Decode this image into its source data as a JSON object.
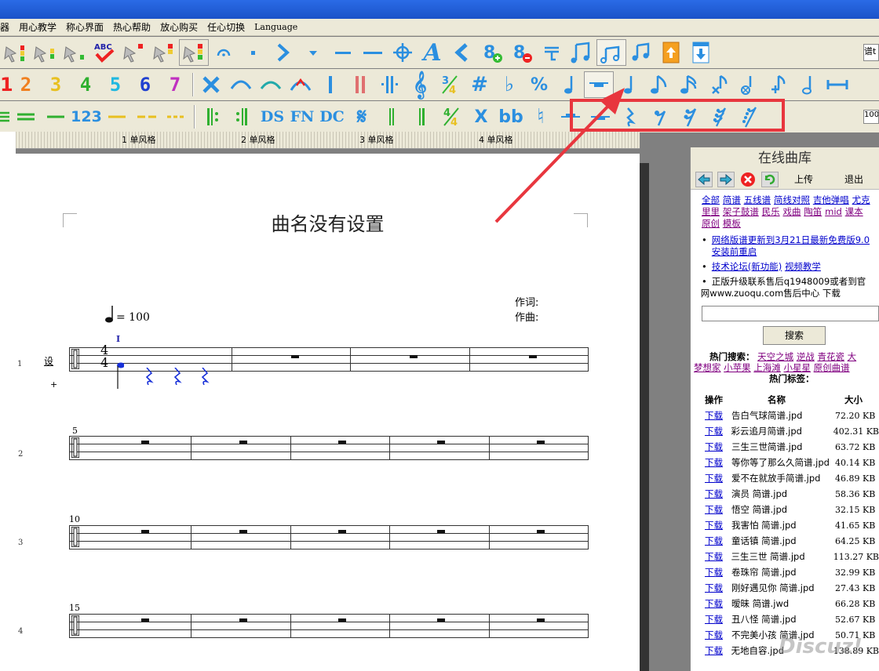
{
  "menu": [
    "器",
    "用心教学",
    "称心界面",
    "热心帮助",
    "放心购买",
    "任心切换",
    "Language"
  ],
  "toolbar2_numbers": [
    "1",
    "2",
    "3",
    "4",
    "5",
    "6",
    "7"
  ],
  "toolbar3_text": [
    "123",
    "DS",
    "FN",
    "DC",
    "X",
    "bb"
  ],
  "right_field_top": "谱t",
  "right_field_mid": "100",
  "ruler": [
    "1 单风格",
    "2 单风格",
    "3 单风格",
    "4 单风格"
  ],
  "score": {
    "title": "曲名没有设置",
    "tempo": "= 100",
    "lyricist": "作词:",
    "composer": "作曲:",
    "marker": "I",
    "setting": "设",
    "plus": "+",
    "time_sig_top": "4",
    "time_sig_bottom": "4",
    "measure_numbers": [
      "5",
      "10",
      "15"
    ],
    "line_numbers": [
      "1",
      "2",
      "3",
      "4"
    ]
  },
  "panel": {
    "title": "在线曲库",
    "upload": "上传",
    "exit": "退出",
    "categories_line1": [
      "全部",
      "简谱",
      "五线谱",
      "简线对照",
      "吉他弹唱",
      "尤克"
    ],
    "categories_line2": [
      "里里",
      "架子鼓谱",
      "民乐",
      "戏曲",
      "陶笛",
      "mid",
      "课本"
    ],
    "categories_line3": [
      "原创",
      "模板"
    ],
    "news1": "网络版谱更新到3月21日最新免费版9.0安装前重启",
    "news2a": "技术论坛(新功能)",
    "news2b": "视频教学",
    "news3": "正版升级联系售后q1948009或者到官网www.zuoqu.com售后中心 下载",
    "search_button": "搜索",
    "hot_search_label": "热门搜索：",
    "hot_search": [
      "天空之城",
      "逆战",
      "青花瓷",
      "大",
      "梦想家",
      "小苹果",
      "上海滩",
      "小星星",
      "原创曲谱"
    ],
    "hot_tags_label": "热门标签：",
    "col_action": "操作",
    "col_name": "名称",
    "col_size": "大小",
    "files": [
      {
        "action": "下载",
        "name": "告白气球简谱.jpd",
        "size": "72.20 KB"
      },
      {
        "action": "下载",
        "name": "彩云追月简谱.jpd",
        "size": "402.31 KB"
      },
      {
        "action": "下载",
        "name": "三生三世简谱.jpd",
        "size": "63.72 KB"
      },
      {
        "action": "下载",
        "name": "等你等了那么久简谱.jpd",
        "size": "40.14 KB"
      },
      {
        "action": "下载",
        "name": "爱不在就放手简谱.jpd",
        "size": "46.89 KB"
      },
      {
        "action": "下载",
        "name": "演员 简谱.jpd",
        "size": "58.36 KB"
      },
      {
        "action": "下载",
        "name": "悟空 简谱.jpd",
        "size": "32.15 KB"
      },
      {
        "action": "下载",
        "name": "我害怕 简谱.jpd",
        "size": "41.65 KB"
      },
      {
        "action": "下载",
        "name": "童话镇 简谱.jpd",
        "size": "64.25 KB"
      },
      {
        "action": "下载",
        "name": "三生三世 简谱.jpd",
        "size": "113.27 KB"
      },
      {
        "action": "下载",
        "name": "卷珠帘 简谱.jpd",
        "size": "32.99 KB"
      },
      {
        "action": "下载",
        "name": "刚好遇见你 简谱.jpd",
        "size": "27.43 KB"
      },
      {
        "action": "下载",
        "name": "暧昧 简谱.jwd",
        "size": "66.28 KB"
      },
      {
        "action": "下载",
        "name": "丑八怪 简谱.jpd",
        "size": "52.67 KB"
      },
      {
        "action": "下载",
        "name": "不完美小孩 简谱.jpd",
        "size": "50.71 KB"
      },
      {
        "action": "下载",
        "name": "无地自容.jpd",
        "size": "138.89 KB"
      }
    ]
  },
  "watermark": "Discuz!",
  "colors": {
    "highlight": "#e8363e",
    "titlebar": "#1b52c8",
    "link": "#0000cc",
    "icon_blue": "#2b8fe0"
  }
}
